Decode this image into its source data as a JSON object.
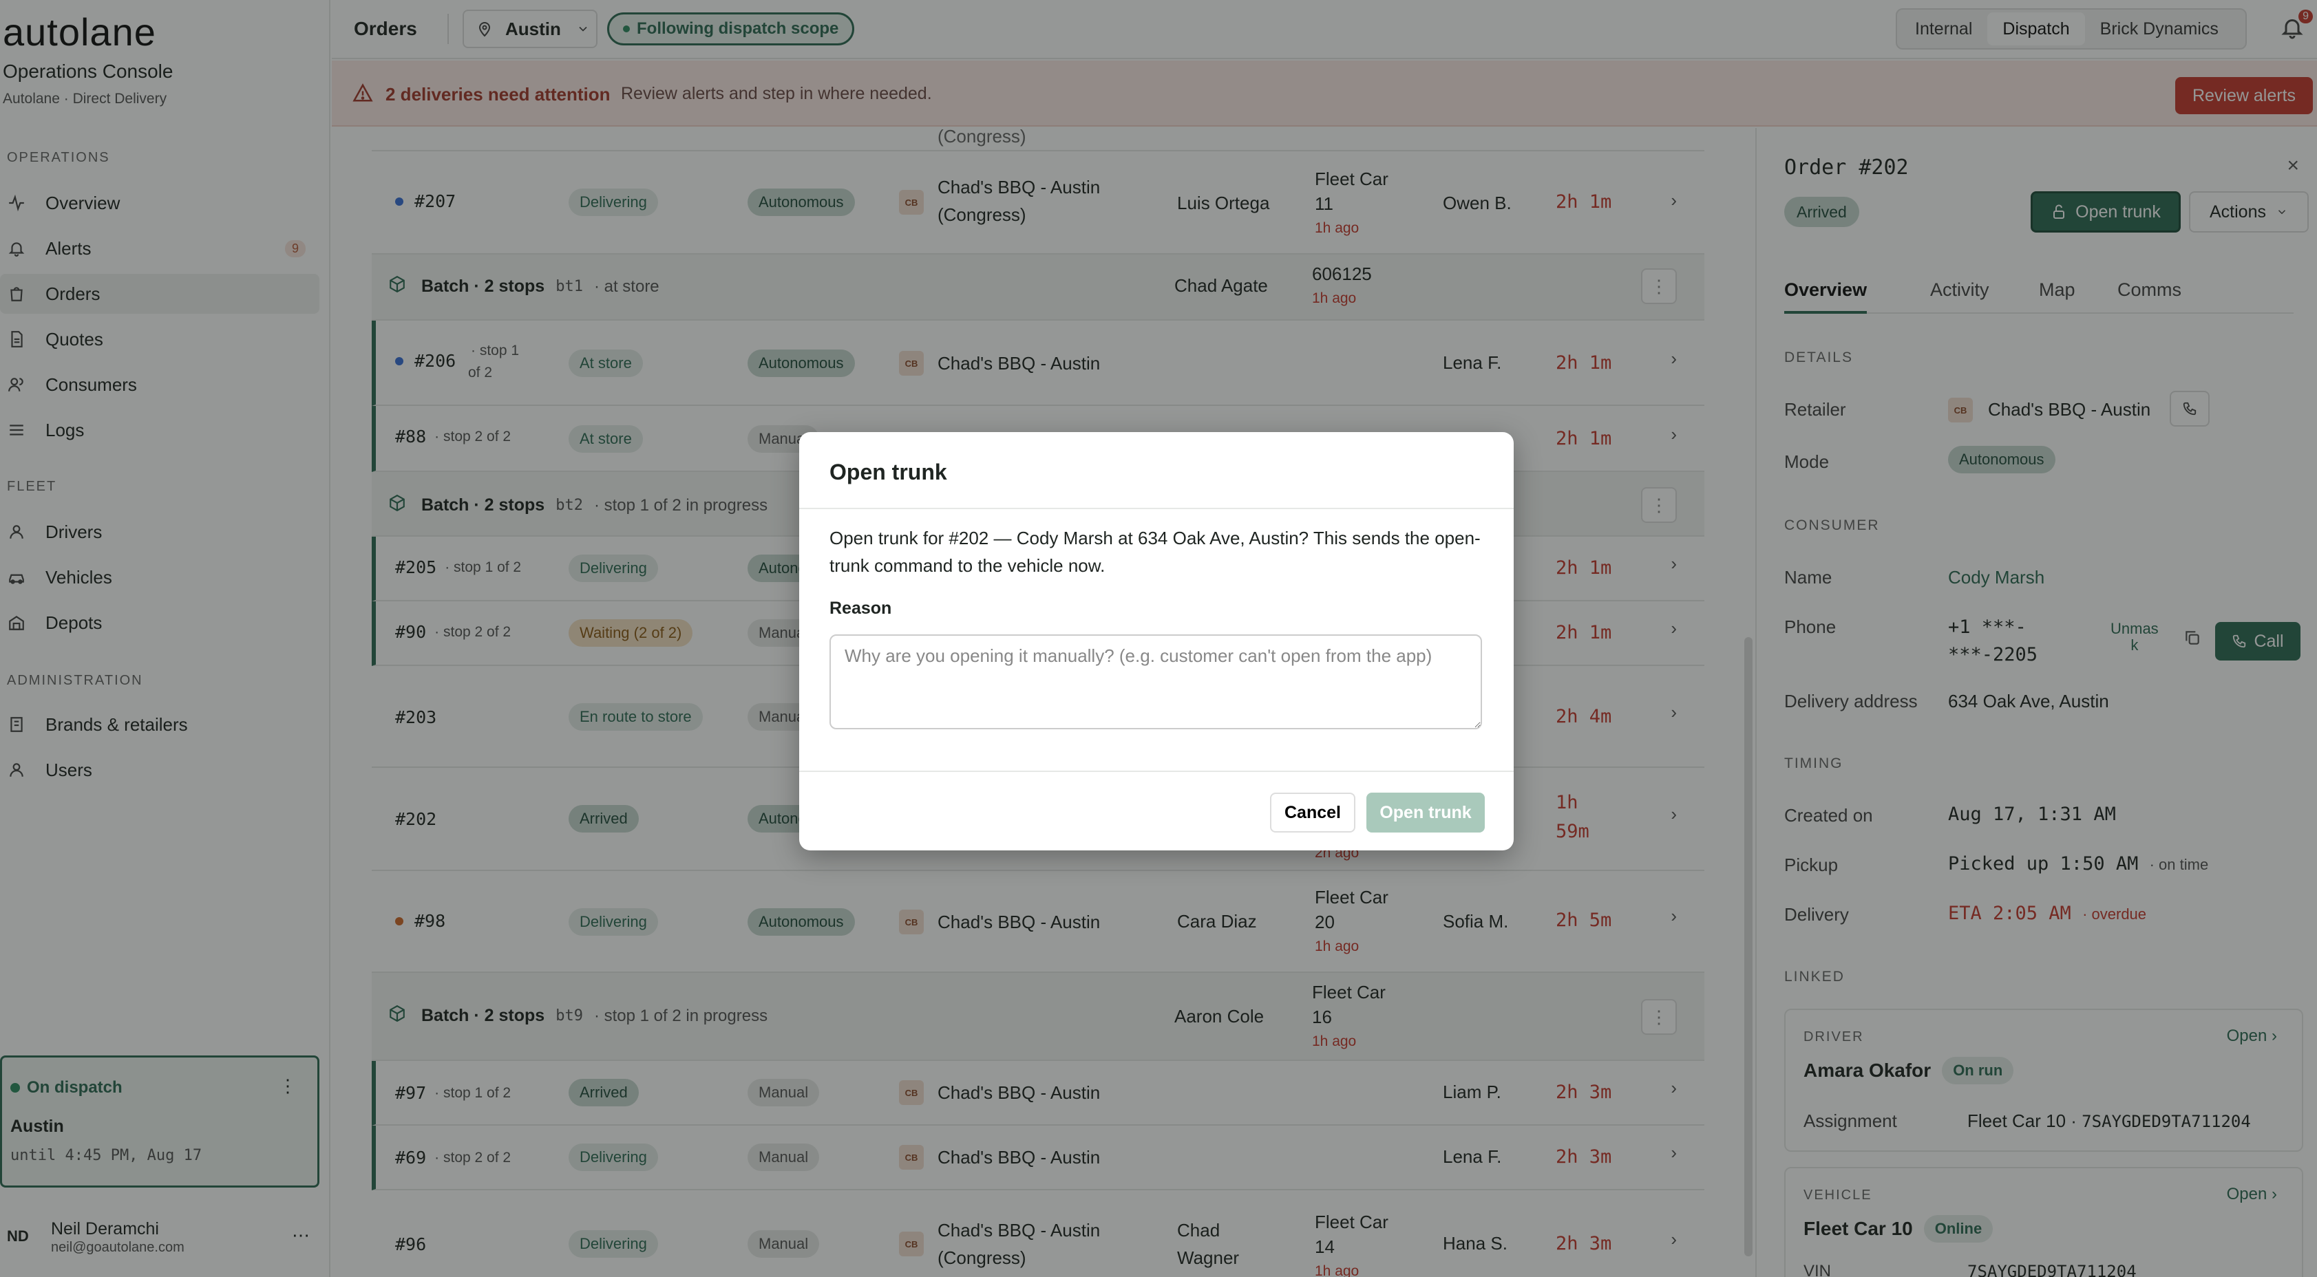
{
  "sidebar": {
    "logo": "autolane",
    "title": "Operations Console",
    "subtitle": "Autolane · Direct Delivery",
    "sections": {
      "operations": "OPERATIONS",
      "fleet": "FLEET",
      "administration": "ADMINISTRATION"
    },
    "items": {
      "overview": "Overview",
      "alerts": "Alerts",
      "alerts_count": "9",
      "orders": "Orders",
      "quotes": "Quotes",
      "consumers": "Consumers",
      "logs": "Logs",
      "drivers": "Drivers",
      "vehicles": "Vehicles",
      "depots": "Depots",
      "brands": "Brands & retailers",
      "users": "Users"
    },
    "dispatch": {
      "status": "On dispatch",
      "city": "Austin",
      "until": "until 4:45 PM, Aug 17"
    },
    "user": {
      "initials": "ND",
      "name": "Neil Deramchi",
      "email": "neil@goautolane.com"
    }
  },
  "topbar": {
    "title": "Orders",
    "city": "Austin",
    "scope": "Following dispatch scope",
    "views": {
      "internal": "Internal",
      "dispatch": "Dispatch",
      "brick": "Brick Dynamics"
    },
    "notif_count": "9"
  },
  "alert": {
    "title": "2 deliveries need attention",
    "text": "Review alerts and step in where needed.",
    "button": "Review alerts"
  },
  "table": {
    "top_partial": "(Congress)",
    "rows": [
      {
        "id": "#207",
        "status": "Delivering",
        "mode": "Autonomous",
        "retailer_badge": "CB",
        "retailer": "Chad's BBQ - Austin",
        "retailer2": "(Congress)",
        "driver": "Luis Ortega",
        "veh1": "Fleet Car",
        "veh2": "11",
        "veh_ago": "1h ago",
        "consumer": "Owen B.",
        "eta": "2h 1m"
      },
      {
        "batch_title": "Batch · 2 stops",
        "batch_code": "bt1",
        "batch_state": "· at store",
        "driver": "Chad Agate",
        "veh1": "606125",
        "veh_ago": "1h ago"
      },
      {
        "id": "#206",
        "sub1": "· stop 1",
        "sub2": "of 2",
        "status": "At store",
        "mode": "Autonomous",
        "retailer_badge": "CB",
        "retailer": "Chad's BBQ - Austin",
        "consumer": "Lena F.",
        "eta": "2h 1m"
      },
      {
        "id": "#88",
        "sub": "· stop 2 of 2",
        "status": "At store",
        "mode": "Manual",
        "eta": "2h 1m"
      },
      {
        "batch_title": "Batch · 2 stops",
        "batch_code": "bt2",
        "batch_state": "· stop 1 of 2 in progress"
      },
      {
        "id": "#205",
        "sub": "· stop 1 of 2",
        "status": "Delivering",
        "mode": "Autonomous",
        "eta": "2h 1m"
      },
      {
        "id": "#90",
        "sub": "· stop 2 of 2",
        "status": "Waiting (2 of 2)",
        "mode": "Manual",
        "eta": "2h 1m"
      },
      {
        "id": "#203",
        "status": "En route to store",
        "mode": "Manual",
        "eta": "2h 4m"
      },
      {
        "id": "#202",
        "status": "Arrived",
        "mode": "Autonomous",
        "veh_ago": "2h ago",
        "eta1": "1h",
        "eta2": "59m"
      },
      {
        "id": "#98",
        "status": "Delivering",
        "mode": "Autonomous",
        "retailer_badge": "CB",
        "retailer": "Chad's BBQ - Austin",
        "driver": "Cara Diaz",
        "veh1": "Fleet Car",
        "veh2": "20",
        "veh_ago": "1h ago",
        "consumer": "Sofia M.",
        "eta": "2h 5m"
      },
      {
        "batch_title": "Batch · 2 stops",
        "batch_code": "bt9",
        "batch_state": "· stop 1 of 2 in progress",
        "driver": "Aaron Cole",
        "veh1": "Fleet Car",
        "veh2": "16",
        "veh_ago": "1h ago"
      },
      {
        "id": "#97",
        "sub": "· stop 1 of 2",
        "status": "Arrived",
        "mode": "Manual",
        "retailer_badge": "CB",
        "retailer": "Chad's BBQ - Austin",
        "consumer": "Liam P.",
        "eta": "2h 3m"
      },
      {
        "id": "#69",
        "sub": "· stop 2 of 2",
        "status": "Delivering",
        "mode": "Manual",
        "retailer_badge": "CB",
        "retailer": "Chad's BBQ - Austin",
        "consumer": "Lena F.",
        "eta": "2h 3m"
      },
      {
        "id": "#96",
        "status": "Delivering",
        "mode": "Manual",
        "retailer_badge": "CB",
        "retailer": "Chad's BBQ - Austin",
        "retailer2": "(Congress)",
        "driver": "Chad",
        "driver2": "Wagner",
        "veh1": "Fleet Car",
        "veh2": "14",
        "veh_ago": "1h ago",
        "consumer": "Hana S.",
        "eta": "2h 3m"
      }
    ]
  },
  "panel": {
    "title": "Order #202",
    "status": "Arrived",
    "open_trunk": "Open trunk",
    "actions": "Actions",
    "tabs": {
      "overview": "Overview",
      "activity": "Activity",
      "map": "Map",
      "comms": "Comms"
    },
    "details": {
      "heading": "DETAILS",
      "retailer_label": "Retailer",
      "retailer_badge": "CB",
      "retailer": "Chad's BBQ - Austin",
      "mode_label": "Mode",
      "mode": "Autonomous"
    },
    "consumer": {
      "heading": "CONSUMER",
      "name_label": "Name",
      "name": "Cody Marsh",
      "phone_label": "Phone",
      "phone1": "+1 ***-",
      "phone2": "***-2205",
      "unmask1": "Unmas",
      "unmask2": "k",
      "call": "Call",
      "address_label": "Delivery address",
      "address": "634 Oak Ave, Austin"
    },
    "timing": {
      "heading": "TIMING",
      "created_label": "Created on",
      "created": "Aug 17, 1:31 AM",
      "pickup_label": "Pickup",
      "pickup": "Picked up 1:50 AM",
      "pickup_note": "· on time",
      "delivery_label": "Delivery",
      "delivery": "ETA 2:05 AM",
      "delivery_note": "· overdue"
    },
    "linked": {
      "heading": "LINKED",
      "driver_heading": "DRIVER",
      "driver_open": "Open",
      "driver_name": "Amara Okafor",
      "driver_state": "On run",
      "assignment_label": "Assignment",
      "assignment_car": "Fleet Car 10 · ",
      "assignment_vin": "7SAYGDED9TA711204",
      "vehicle_heading": "VEHICLE",
      "vehicle_open": "Open",
      "vehicle_name": "Fleet Car 10",
      "vehicle_state": "Online",
      "vin_label": "VIN",
      "vin": "7SAYGDED9TA711204"
    }
  },
  "modal": {
    "title": "Open trunk",
    "body": "Open trunk for #202 — Cody Marsh at 634 Oak Ave, Austin? This sends the open-trunk command to the vehicle now.",
    "reason_label": "Reason",
    "reason_placeholder": "Why are you opening it manually? (e.g. customer can't open from the app)",
    "cancel": "Cancel",
    "confirm": "Open trunk"
  }
}
